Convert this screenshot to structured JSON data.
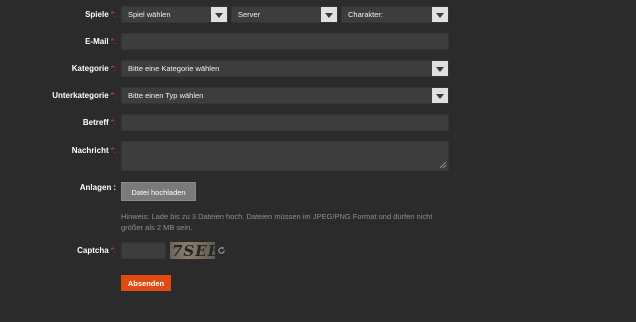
{
  "form": {
    "required_mark": "*:",
    "games": {
      "label": "Spiele",
      "game_select": "Spiel wählen",
      "server_select": "Server",
      "character_select": "Charakter:"
    },
    "email": {
      "label": "E-Mail",
      "value": ""
    },
    "category": {
      "label": "Kategorie",
      "selected": "Bitte eine Kategorie wählen"
    },
    "subcategory": {
      "label": "Unterkategorie",
      "selected": "Bitte einen Typ wählen"
    },
    "subject": {
      "label": "Betreff",
      "value": ""
    },
    "message": {
      "label": "Nachricht",
      "value": ""
    },
    "attachments": {
      "label": "Anlagen",
      "colon": ":",
      "upload_label": "Datei hochladen",
      "hint": "Hinweis: Lade bis zu 3 Dateien hoch. Dateien müssen im JPEG/PNG Format und dürfen nicht größer als 2 MB sein."
    },
    "captcha": {
      "label": "Captcha",
      "value": "",
      "image_text": "7SEE"
    },
    "submit_label": "Absenden"
  },
  "icons": {
    "dropdown": "chevron-down-icon",
    "refresh": "refresh-icon",
    "resize": "resize-grip-icon"
  },
  "colors": {
    "background": "#2b2b2b",
    "field": "#3d3d3d",
    "required": "#e8442a",
    "submit": "#e04b12"
  }
}
